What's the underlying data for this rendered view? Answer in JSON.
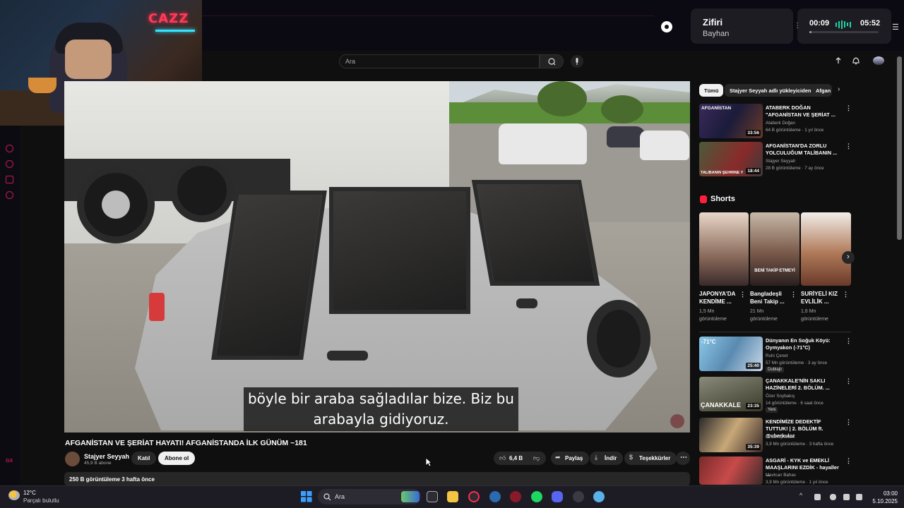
{
  "music_player": {
    "neon_sign": "CAZZ",
    "song_title": "Zifiri",
    "artist": "Bayhan",
    "time_current": "00:09",
    "time_total": "05:52",
    "progress": 0.03
  },
  "header": {
    "search_placeholder": "Ara"
  },
  "video": {
    "subtitle_line1": "böyle bir araba sağladılar bize. Biz bu",
    "subtitle_line2": "arabayla gidiyoruz.",
    "title": "AFGANİSTAN VE ŞERİAT HAYATI! AFGANİSTANDA İLK GÜNÜM ~181",
    "channel_name": "Stajyer Seyyah",
    "channel_subs": "45,9 B abone",
    "join_label": "Katıl",
    "subscribe_label": "Abone ol",
    "like_count": "6,4 B",
    "share_label": "Paylaş",
    "download_label": "İndir",
    "thanks_label": "Teşekkürler",
    "description_meta": "250 B görüntüleme  3 hafta önce"
  },
  "chips": [
    "Tümü",
    "Stajyer Seyyah adlı yükleyiciden",
    "Afgan"
  ],
  "recommended_top": [
    {
      "title": "ATABERK DOĞAN \"AFGANİSTAN VE ŞERİAT ...",
      "channel": "Ataberk Doğan",
      "meta": "64 B görüntüleme · 1 yıl önce",
      "duration": "33:56",
      "thumb_text": "AFGANİSTAN"
    },
    {
      "title": "AFGANİSTAN'DA ZORLU YOLCULUĞUM TALİBANIN ...",
      "channel": "Stajyer Seyyah",
      "meta": "28 B görüntüleme · 7 ay önce",
      "duration": "18:44",
      "thumb_text": "TALİBANIN ŞEHRİNE YO"
    }
  ],
  "shorts": {
    "header": "Shorts",
    "items": [
      {
        "title": "JAPONYA'DA KENDİME ...",
        "meta1": "1,5 Mn",
        "meta2": "görüntüleme"
      },
      {
        "title": "Bangladeşli Beni Takip ...",
        "meta1": "21 Mn",
        "meta2": "görüntüleme",
        "thumb_text": "BENİ TAKİP ETMEYİ"
      },
      {
        "title": "SURİYELİ KIZ EVLİLİK ...",
        "meta1": "1,6 Mn",
        "meta2": "görüntüleme"
      }
    ]
  },
  "recommended_bottom": [
    {
      "title": "Dünyanın En Soğuk Köyü: Oymyakon (-71°C)",
      "channel": "Ruhi Çenet",
      "meta": "57 Mn görüntüleme · 3 ay önce",
      "badge": "Dublajlı",
      "duration": "25:40",
      "thumb_text": "-71°C"
    },
    {
      "title": "ÇANAKKALE'NİN SAKLI HAZİNELERİ 2. BÖLÜM. ...",
      "channel": "Özer Soybakış",
      "meta": "14 görüntüleme · 6 saat önce",
      "badge": "Yeni",
      "duration": "23:35",
      "thumb_text": "ÇANAKKALE"
    },
    {
      "title": "KENDİMİZE DEDEKTİF TUTTUK! | 2. BÖLÜM  ft. @uberkuloz",
      "channel": "Orkun Işıtmak",
      "meta": "3,9 Mn görüntüleme · 3 hafta önce",
      "duration": "35:39"
    },
    {
      "title": "ASGARİ - KYK ve EMEKLİ MAAŞLARINI EZDİK - hayaller ...",
      "channel": "Mevlcan Bahav",
      "meta": "3,9 Mn görüntüleme · 1 yıl önce"
    }
  ],
  "taskbar": {
    "temperature": "12°C",
    "weather": "Parçalı bulutlu",
    "search_placeholder": "Ara",
    "time": "03:00",
    "date": "5.10.2025"
  },
  "colors": {
    "accent": "#ff0033",
    "background": "#0f0f0f",
    "rail_accent": "#c2185b"
  }
}
